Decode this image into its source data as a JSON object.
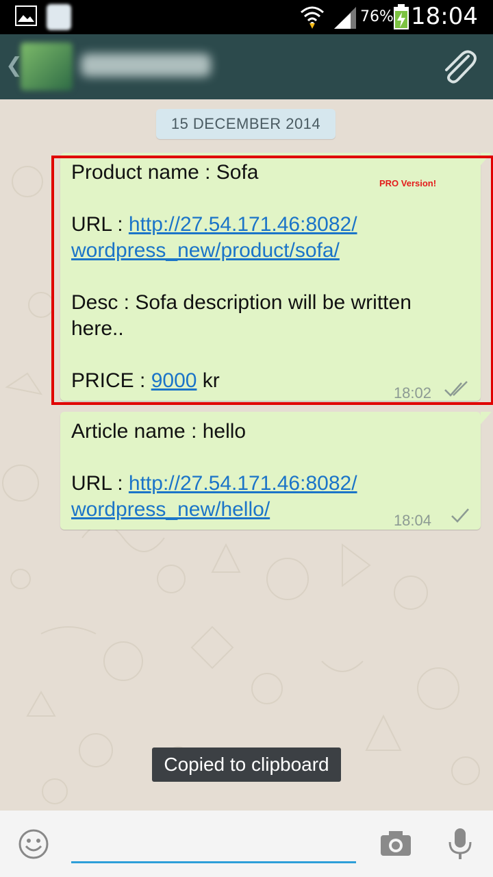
{
  "status_bar": {
    "battery_percent": "76%",
    "time": "18:04"
  },
  "header": {
    "icons": [
      "back-icon",
      "attach-icon"
    ]
  },
  "chat": {
    "date_separator": "15 DECEMBER 2014",
    "messages": [
      {
        "product_label": "Product name : Sofa",
        "pro_badge": "PRO Version!",
        "url_label": "URL : ",
        "url_line1": "http://27.54.171.46:8082/",
        "url_line2": "wordpress_new/product/sofa/",
        "desc_line1": "Desc : Sofa description will be written",
        "desc_line2": "here..",
        "price_label": "PRICE : ",
        "price_value": "9000",
        "price_unit": " kr",
        "time": "18:02",
        "status": "double-tick"
      },
      {
        "article_label": "Article name : hello",
        "url_label": "URL : ",
        "url_line1": "http://27.54.171.46:8082/",
        "url_line2": "wordpress_new/hello/",
        "time": "18:04",
        "status": "single-tick"
      }
    ]
  },
  "toast": "Copied to clipboard",
  "input_bar": {
    "icons": [
      "emoji-icon",
      "camera-icon",
      "mic-icon"
    ],
    "accent_color": "#2e9fd8"
  }
}
